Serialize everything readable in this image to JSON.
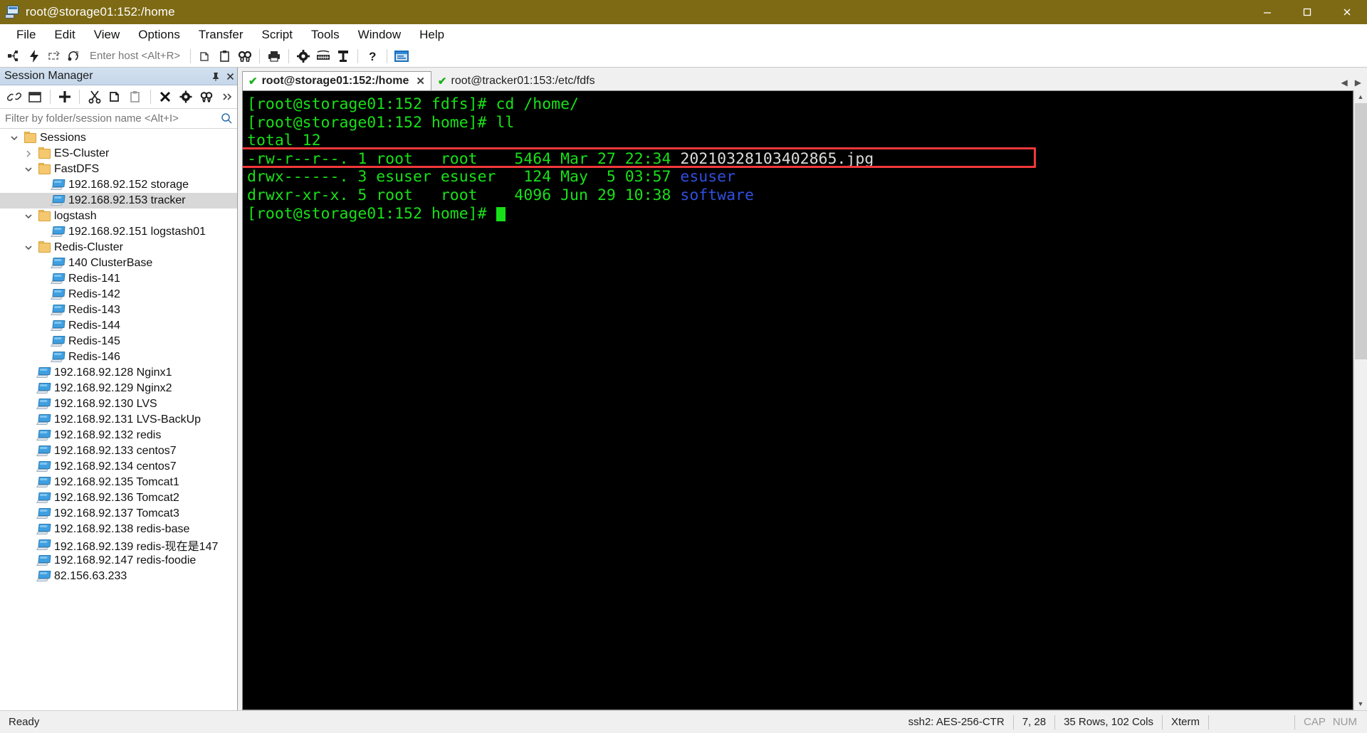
{
  "window": {
    "title": "root@storage01:152:/home",
    "icon": "securecrt-icon",
    "buttons": {
      "minimize": "minimize-button",
      "maximize": "maximize-button",
      "close": "close-button"
    }
  },
  "menubar": {
    "items": [
      "File",
      "Edit",
      "View",
      "Options",
      "Transfer",
      "Script",
      "Tools",
      "Window",
      "Help"
    ]
  },
  "toolbar": {
    "host_placeholder": "Enter host <Alt+R>",
    "icons": [
      "connect-icon",
      "quick-connect-icon",
      "reconnect-icon",
      "connect-in-tab-icon",
      "copy-icon",
      "paste-icon",
      "find-icon",
      "print-icon",
      "settings-icon",
      "keymap-icon",
      "session-options-icon",
      "help-icon",
      "log-session-icon"
    ]
  },
  "session_manager": {
    "header_title": "Session Manager",
    "header_buttons": [
      "pin-icon",
      "close-icon"
    ],
    "toolbar_icons": [
      "connect-link-icon",
      "new-window-icon",
      "new-session-icon",
      "cut-icon",
      "copy-icon",
      "paste-icon",
      "delete-icon",
      "properties-icon",
      "find-icon",
      "overflow-icon"
    ],
    "filter_placeholder": "Filter by folder/session name <Alt+I>",
    "filter_value": "",
    "tree": [
      {
        "label": "Sessions",
        "type": "folder",
        "depth": 0,
        "expanded": true,
        "selected": false
      },
      {
        "label": "ES-Cluster",
        "type": "folder",
        "depth": 1,
        "expanded": false,
        "selected": false
      },
      {
        "label": "FastDFS",
        "type": "folder",
        "depth": 1,
        "expanded": true,
        "selected": false
      },
      {
        "label": "192.168.92.152 storage",
        "type": "session",
        "depth": 2,
        "selected": false
      },
      {
        "label": "192.168.92.153 tracker",
        "type": "session",
        "depth": 2,
        "selected": true
      },
      {
        "label": "logstash",
        "type": "folder",
        "depth": 1,
        "expanded": true,
        "selected": false
      },
      {
        "label": "192.168.92.151 logstash01",
        "type": "session",
        "depth": 2,
        "selected": false
      },
      {
        "label": "Redis-Cluster",
        "type": "folder",
        "depth": 1,
        "expanded": true,
        "selected": false
      },
      {
        "label": "140 ClusterBase",
        "type": "session",
        "depth": 2,
        "selected": false
      },
      {
        "label": "Redis-141",
        "type": "session",
        "depth": 2,
        "selected": false
      },
      {
        "label": "Redis-142",
        "type": "session",
        "depth": 2,
        "selected": false
      },
      {
        "label": "Redis-143",
        "type": "session",
        "depth": 2,
        "selected": false
      },
      {
        "label": "Redis-144",
        "type": "session",
        "depth": 2,
        "selected": false
      },
      {
        "label": "Redis-145",
        "type": "session",
        "depth": 2,
        "selected": false
      },
      {
        "label": "Redis-146",
        "type": "session",
        "depth": 2,
        "selected": false
      },
      {
        "label": "192.168.92.128 Nginx1",
        "type": "session",
        "depth": 1,
        "selected": false
      },
      {
        "label": "192.168.92.129 Nginx2",
        "type": "session",
        "depth": 1,
        "selected": false
      },
      {
        "label": "192.168.92.130 LVS",
        "type": "session",
        "depth": 1,
        "selected": false
      },
      {
        "label": "192.168.92.131 LVS-BackUp",
        "type": "session",
        "depth": 1,
        "selected": false
      },
      {
        "label": "192.168.92.132 redis",
        "type": "session",
        "depth": 1,
        "selected": false
      },
      {
        "label": "192.168.92.133 centos7",
        "type": "session",
        "depth": 1,
        "selected": false
      },
      {
        "label": "192.168.92.134 centos7",
        "type": "session",
        "depth": 1,
        "selected": false
      },
      {
        "label": "192.168.92.135 Tomcat1",
        "type": "session",
        "depth": 1,
        "selected": false
      },
      {
        "label": "192.168.92.136 Tomcat2",
        "type": "session",
        "depth": 1,
        "selected": false
      },
      {
        "label": "192.168.92.137 Tomcat3",
        "type": "session",
        "depth": 1,
        "selected": false
      },
      {
        "label": "192.168.92.138 redis-base",
        "type": "session",
        "depth": 1,
        "selected": false
      },
      {
        "label": "192.168.92.139 redis-现在是147",
        "type": "session",
        "depth": 1,
        "selected": false
      },
      {
        "label": "192.168.92.147 redis-foodie",
        "type": "session",
        "depth": 1,
        "selected": false
      },
      {
        "label": "82.156.63.233",
        "type": "session",
        "depth": 1,
        "selected": false
      }
    ]
  },
  "tabs": [
    {
      "label": "root@storage01:152:/home",
      "active": true,
      "status": "connected",
      "closable": true
    },
    {
      "label": "root@tracker01:153:/etc/fdfs",
      "active": false,
      "status": "connected",
      "closable": false
    }
  ],
  "terminal": {
    "lines": [
      [
        {
          "t": "[root@storage01:152 fdfs]# cd /home/",
          "c": "g"
        }
      ],
      [
        {
          "t": "[root@storage01:152 home]# ll",
          "c": "g"
        }
      ],
      [
        {
          "t": "total 12",
          "c": "g"
        }
      ],
      [
        {
          "t": "-rw-r--r--. 1 root   root    5464 Mar 27 22:34 ",
          "c": "g"
        },
        {
          "t": "20210328103402865.jpg",
          "c": "wh"
        }
      ],
      [
        {
          "t": "drwx------. 3 esuser esuser   124 May  5 03:57 ",
          "c": "g"
        },
        {
          "t": "esuser",
          "c": "bl"
        }
      ],
      [
        {
          "t": "drwxr-xr-x. 5 root   root    4096 Jun 29 10:38 ",
          "c": "g"
        },
        {
          "t": "software",
          "c": "bl"
        }
      ],
      [
        {
          "t": "[root@storage01:152 home]# ",
          "c": "g"
        }
      ]
    ],
    "highlight": {
      "color": "#f2383a",
      "target_line": "-rw-r--r--. 1 root   root    5464 Mar 27 22:34 20210328103402865.jpg"
    },
    "colors": {
      "background": "#000000",
      "green": "#18e018",
      "blue": "#2f4fe0",
      "white": "#dcdcdc"
    }
  },
  "statusbar": {
    "ready": "Ready",
    "cipher": "ssh2: AES-256-CTR",
    "position": "7, 28",
    "size": "35 Rows, 102 Cols",
    "emulation": "Xterm",
    "caps": "CAP",
    "num": "NUM"
  }
}
